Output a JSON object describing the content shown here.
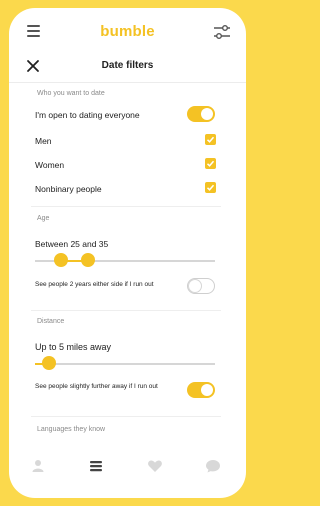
{
  "app": {
    "brand": "bumble"
  },
  "header": {
    "title": "Date filters"
  },
  "who": {
    "section_label": "Who you want to date",
    "open_to_everyone": {
      "label": "I'm open to dating everyone",
      "on": true
    },
    "options": [
      {
        "label": "Men",
        "checked": true
      },
      {
        "label": "Women",
        "checked": true
      },
      {
        "label": "Nonbinary people",
        "checked": true
      }
    ]
  },
  "age": {
    "section_label": "Age",
    "value_text": "Between 25 and 35",
    "min": 25,
    "max": 35,
    "flex_text": "See people 2 years either side if I run out",
    "flex_on": false
  },
  "distance": {
    "section_label": "Distance",
    "value_text": "Up to 5 miles away",
    "miles": 5,
    "flex_text": "See people slightly further away if I run out",
    "flex_on": true
  },
  "languages": {
    "section_label": "Languages they know"
  },
  "icons": {
    "menu": "menu-icon",
    "filter": "filter-sliders-icon",
    "close": "close-icon",
    "nav": [
      "profile-icon",
      "people-icon",
      "heart-icon",
      "chat-icon"
    ]
  },
  "colors": {
    "accent": "#f4c224",
    "frame": "#fbd94c"
  }
}
